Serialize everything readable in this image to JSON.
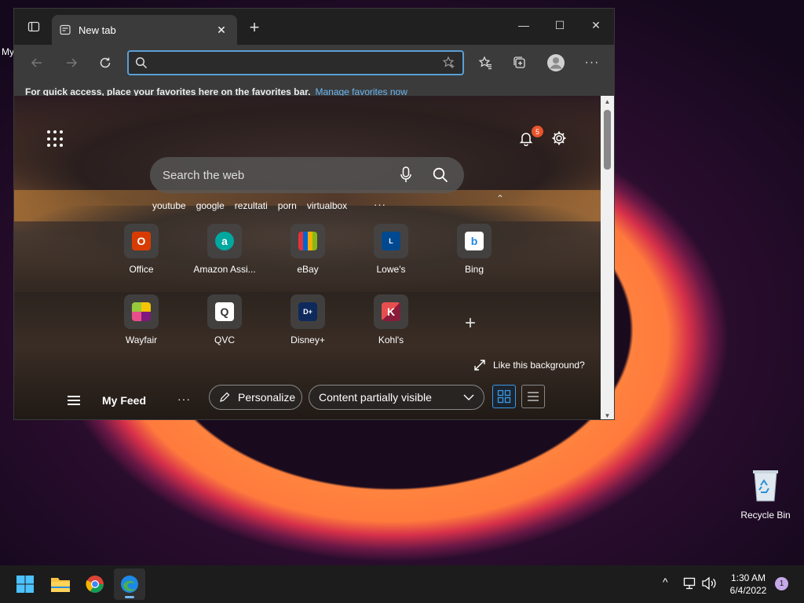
{
  "desktop": {
    "cut_label": "My",
    "recycle_bin_label": "Recycle Bin"
  },
  "browser": {
    "tab_title": "New tab",
    "tab_close": "✕",
    "newtab": "+",
    "win_minimize": "—",
    "win_maximize": "☐",
    "win_close": "✕",
    "address_value": "",
    "address_placeholder": "",
    "favbar_text": "For quick access, place your favorites here on the favorites bar.",
    "favbar_link": "Manage favorites now",
    "more_menu": "···"
  },
  "newtab_page": {
    "notification_count": "5",
    "search_placeholder": "Search the web",
    "trending": [
      "youtube",
      "google",
      "rezultati",
      "porn",
      "virtualbox"
    ],
    "trending_more": "···",
    "quick_links": [
      {
        "label": "Office",
        "icon": "office-icon",
        "color": "#d83b01",
        "glyph": "O"
      },
      {
        "label": "Amazon Assi...",
        "icon": "amazon-assistant-icon",
        "color": "#00a8a0",
        "glyph": "a"
      },
      {
        "label": "eBay",
        "icon": "ebay-icon",
        "color": "#e53238",
        "glyph": "🛍"
      },
      {
        "label": "Lowe's",
        "icon": "lowes-icon",
        "color": "#004990",
        "glyph": "L"
      },
      {
        "label": "Bing",
        "icon": "bing-icon",
        "color": "#ffffff",
        "glyph": "b"
      },
      {
        "label": "Wayfair",
        "icon": "wayfair-icon",
        "color": "#7f187f",
        "glyph": "◆"
      },
      {
        "label": "QVC",
        "icon": "qvc-icon",
        "color": "#ffffff",
        "glyph": "Q"
      },
      {
        "label": "Disney+",
        "icon": "disney-plus-icon",
        "color": "#0e2a5c",
        "glyph": "D+"
      },
      {
        "label": "Kohl's",
        "icon": "kohls-icon",
        "color": "#8a1c3b",
        "glyph": "K"
      }
    ],
    "add_tile": "+",
    "like_background": "Like this background?",
    "feed": {
      "title": "My Feed",
      "more": "···",
      "personalize": "Personalize",
      "content_visibility": "Content partially visible"
    }
  },
  "taskbar": {
    "time": "1:30 AM",
    "date": "6/4/2022",
    "notifications": "1",
    "overflow": "^"
  }
}
